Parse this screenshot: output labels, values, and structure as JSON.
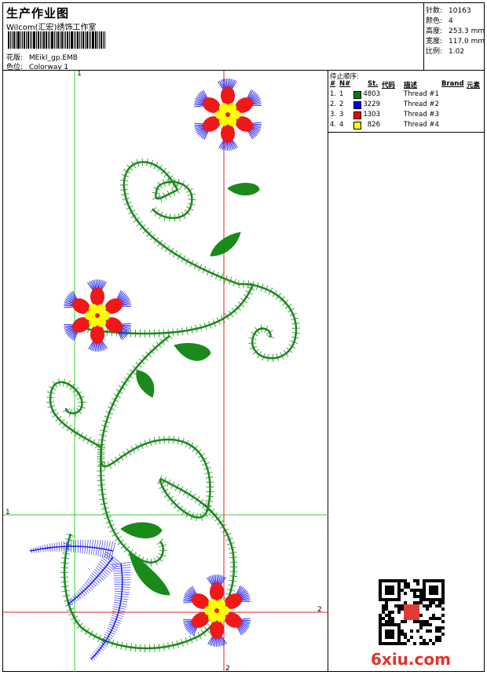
{
  "header": {
    "title": "生产作业图",
    "company": "Wilcom(汇宏)绣饰工作室",
    "design_label": "花版:",
    "design_file": "MEikl_gp.EMB",
    "colorway_label": "色位:",
    "colorway": "Colorway 1"
  },
  "stats": [
    {
      "label": "针数:",
      "value": "10163"
    },
    {
      "label": "颜色:",
      "value": "4"
    },
    {
      "label": "高度:",
      "value": "253.3 mm"
    },
    {
      "label": "宽度:",
      "value": "117.0 mm"
    },
    {
      "label": "比例:",
      "value": "1.02"
    }
  ],
  "thread_panel": {
    "title": "停止顺序:",
    "headers": [
      "#",
      "N#",
      "St.",
      "代码",
      "描述",
      "Brand",
      "元素"
    ],
    "rows": [
      {
        "num": "1.",
        "n": "1",
        "color": "#008000",
        "stitches": "4803",
        "desc": "Thread #1"
      },
      {
        "num": "2.",
        "n": "2",
        "color": "#0000ff",
        "stitches": "3229",
        "desc": "Thread #2"
      },
      {
        "num": "3.",
        "n": "3",
        "color": "#ff0000",
        "stitches": "1303",
        "desc": "Thread #3"
      },
      {
        "num": "4.",
        "n": "4",
        "color": "#ffff00",
        "stitches": "826",
        "desc": "Thread #4"
      }
    ]
  },
  "guides": {
    "marker_1": "1",
    "marker_2": "2"
  },
  "watermark": "6xiu.com",
  "colors": {
    "green": "#1a8a1a",
    "blue": "#1b1bf0",
    "red": "#f01818",
    "yellow": "#ffff00",
    "guide_green": "#2fd62f",
    "guide_red": "#e02020"
  }
}
